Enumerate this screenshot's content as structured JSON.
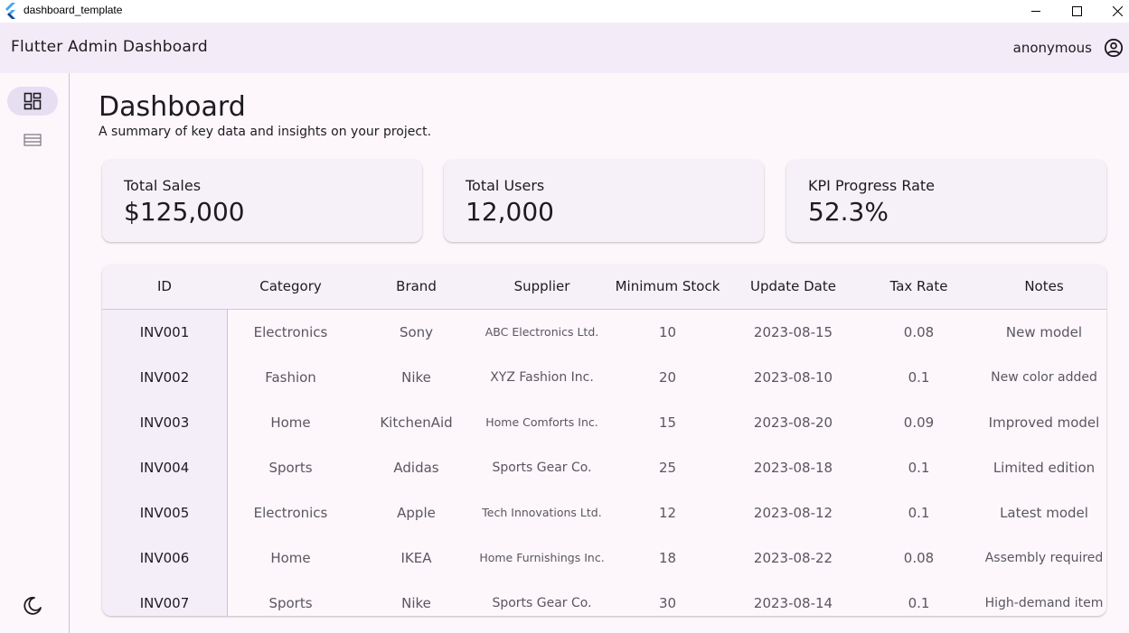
{
  "window": {
    "title": "dashboard_template"
  },
  "appbar": {
    "title": "Flutter Admin Dashboard",
    "user": "anonymous"
  },
  "nav": {
    "items": [
      {
        "icon": "dashboard-icon",
        "active": true
      },
      {
        "icon": "table-icon",
        "active": false
      }
    ],
    "theme_icon": "dark-mode-moon-icon"
  },
  "page": {
    "title": "Dashboard",
    "subtitle": "A summary of key data and insights on your project."
  },
  "cards": [
    {
      "label": "Total Sales",
      "value": "$125,000"
    },
    {
      "label": "Total Users",
      "value": "12,000"
    },
    {
      "label": "KPI Progress Rate",
      "value": "52.3%"
    }
  ],
  "table": {
    "columns": [
      "ID",
      "Category",
      "Brand",
      "Supplier",
      "Minimum Stock",
      "Update Date",
      "Tax Rate",
      "Notes"
    ],
    "rows": [
      [
        "INV001",
        "Electronics",
        "Sony",
        "ABC Electronics Ltd.",
        "10",
        "2023-08-15",
        "0.08",
        "New model"
      ],
      [
        "INV002",
        "Fashion",
        "Nike",
        "XYZ Fashion Inc.",
        "20",
        "2023-08-10",
        "0.1",
        "New color added"
      ],
      [
        "INV003",
        "Home",
        "KitchenAid",
        "Home Comforts Inc.",
        "15",
        "2023-08-20",
        "0.09",
        "Improved model"
      ],
      [
        "INV004",
        "Sports",
        "Adidas",
        "Sports Gear Co.",
        "25",
        "2023-08-18",
        "0.1",
        "Limited edition"
      ],
      [
        "INV005",
        "Electronics",
        "Apple",
        "Tech Innovations Ltd.",
        "12",
        "2023-08-12",
        "0.1",
        "Latest model"
      ],
      [
        "INV006",
        "Home",
        "IKEA",
        "Home Furnishings Inc.",
        "18",
        "2023-08-22",
        "0.08",
        "Assembly required"
      ],
      [
        "INV007",
        "Sports",
        "Nike",
        "Sports Gear Co.",
        "30",
        "2023-08-14",
        "0.1",
        "High-demand item"
      ]
    ]
  }
}
